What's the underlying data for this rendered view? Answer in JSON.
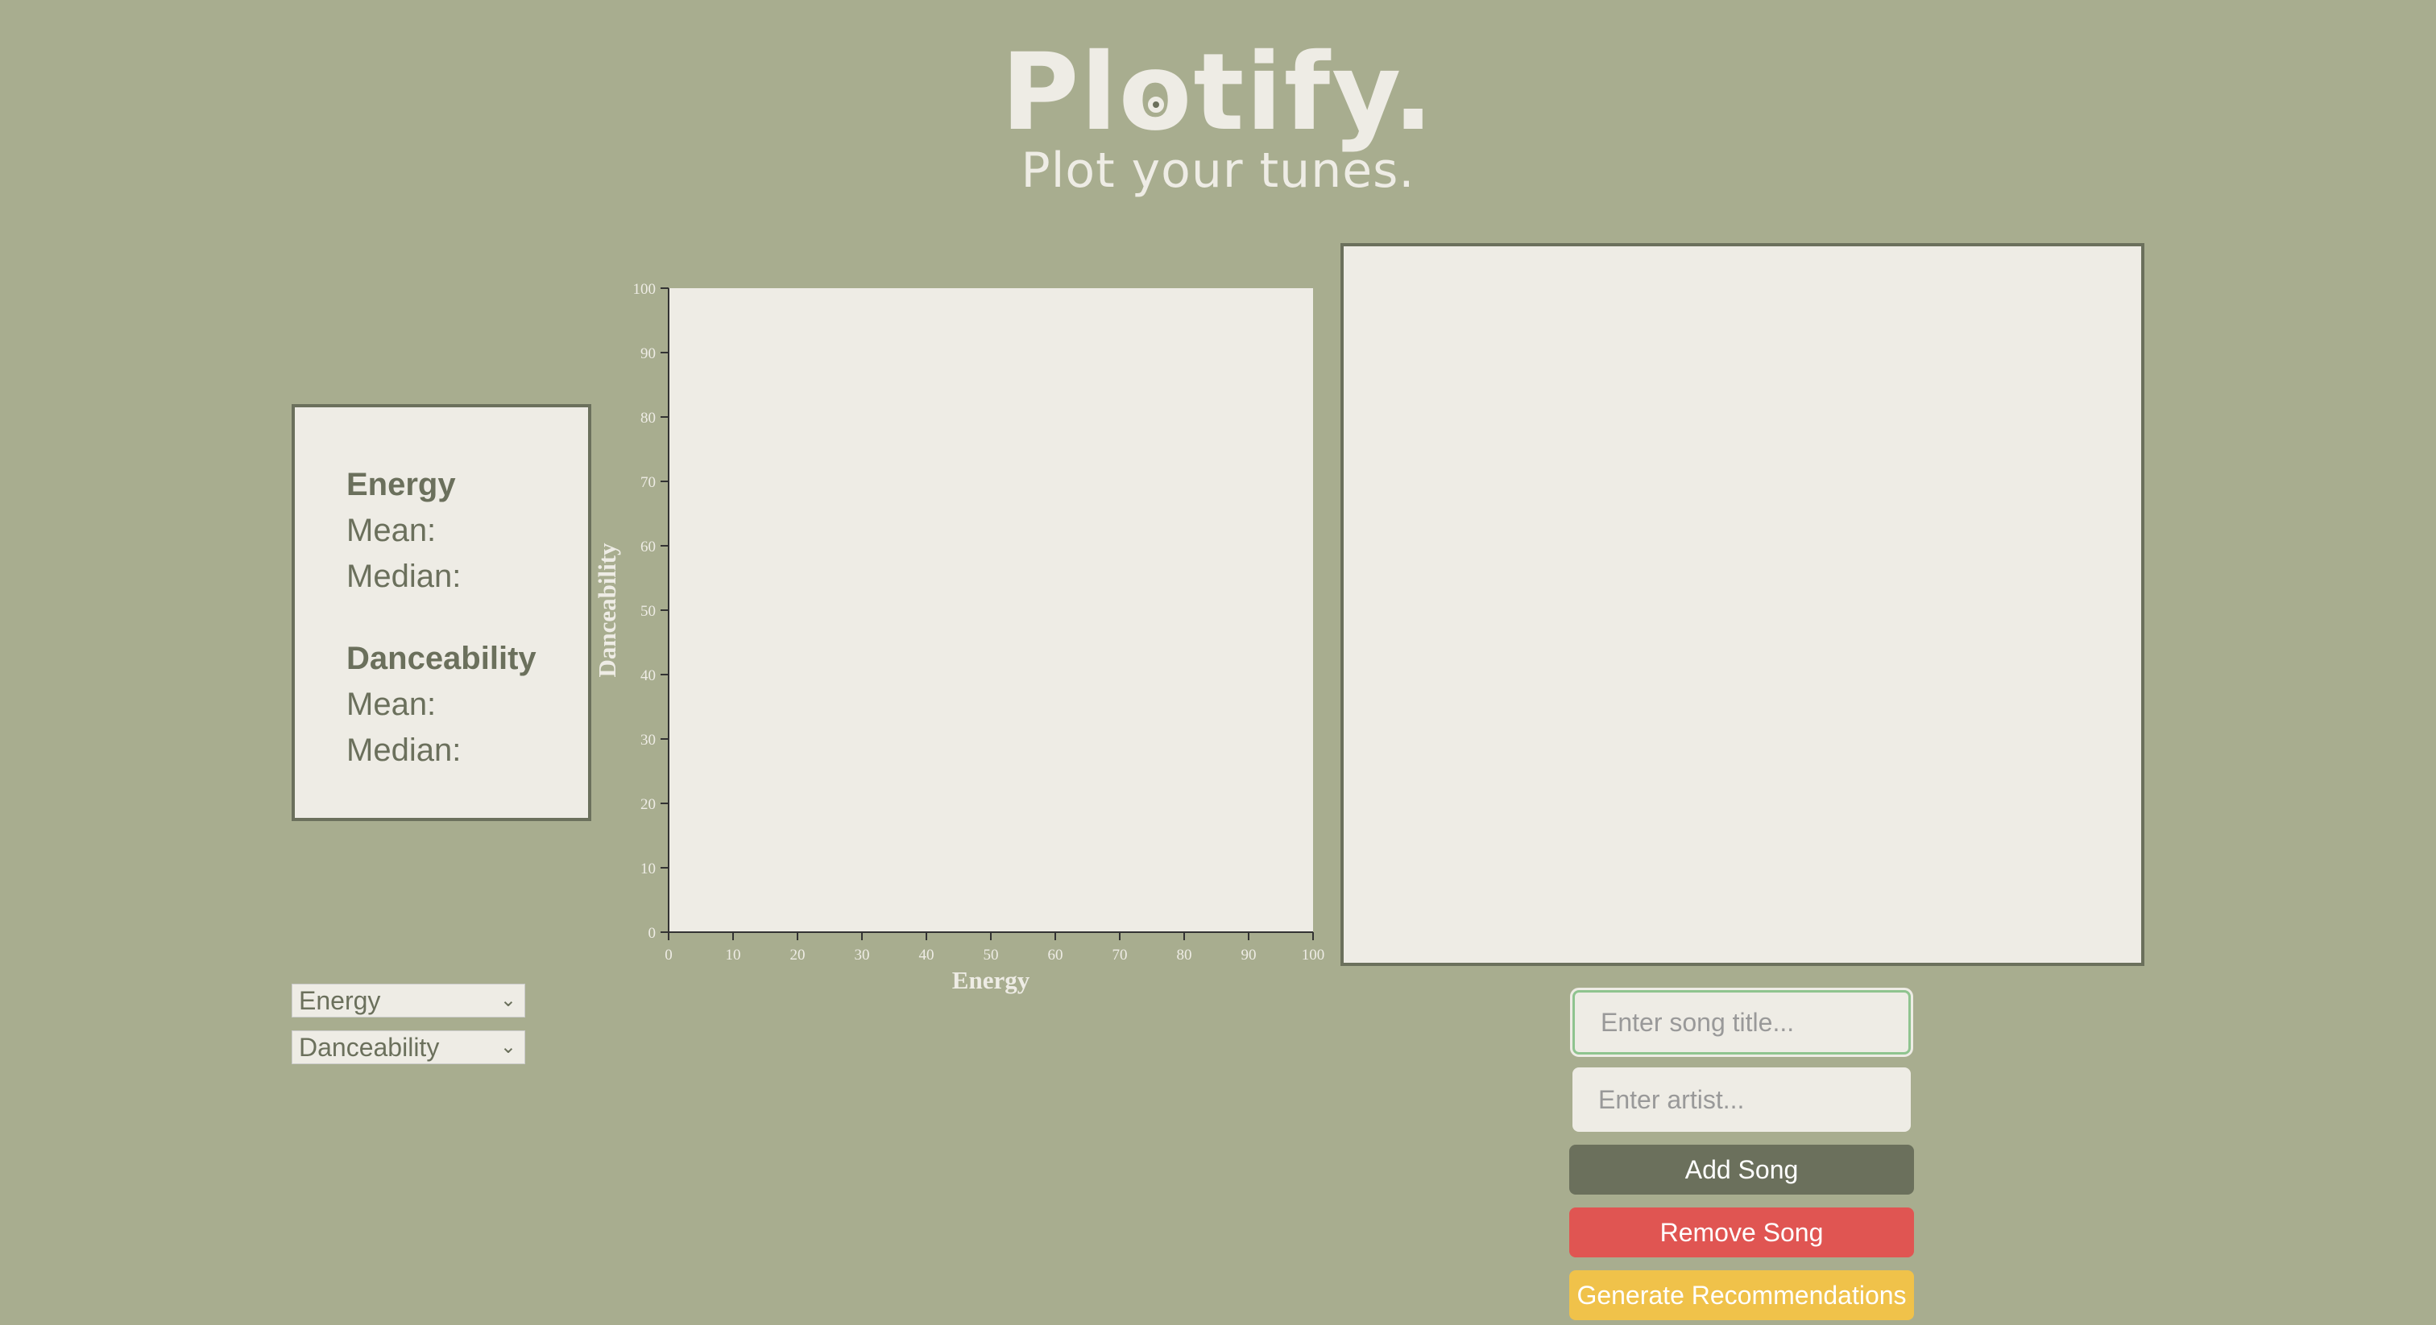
{
  "header": {
    "logo_before": "Pl",
    "logo_o": "o",
    "logo_after": "tify.",
    "tagline": "Plot your tunes."
  },
  "stats": {
    "x_heading": "Energy",
    "x_mean_label": "Mean:",
    "x_median_label": "Median:",
    "y_heading": "Danceability",
    "y_mean_label": "Mean:",
    "y_median_label": "Median:"
  },
  "selects": {
    "x_axis": "Energy",
    "y_axis": "Danceability"
  },
  "form": {
    "title_placeholder": "Enter song title...",
    "artist_placeholder": "Enter artist...",
    "add_label": "Add Song",
    "remove_label": "Remove Song",
    "recommend_label": "Generate Recommendations"
  },
  "chart_data": {
    "type": "scatter",
    "x": [],
    "y": [],
    "title": "",
    "xlabel": "Energy",
    "ylabel": "Danceability",
    "xlim": [
      0,
      100
    ],
    "ylim": [
      0,
      100
    ],
    "xticks": [
      "0",
      "10",
      "20",
      "30",
      "40",
      "50",
      "60",
      "70",
      "80",
      "90",
      "100"
    ],
    "yticks": [
      "0",
      "10",
      "20",
      "30",
      "40",
      "50",
      "60",
      "70",
      "80",
      "90",
      "100"
    ],
    "grid": false
  },
  "colors": {
    "background": "#a8ad8f",
    "panel": "#eeece5",
    "accent": "#6b705c",
    "remove": "#e05552",
    "recommend": "#f0c24a"
  }
}
